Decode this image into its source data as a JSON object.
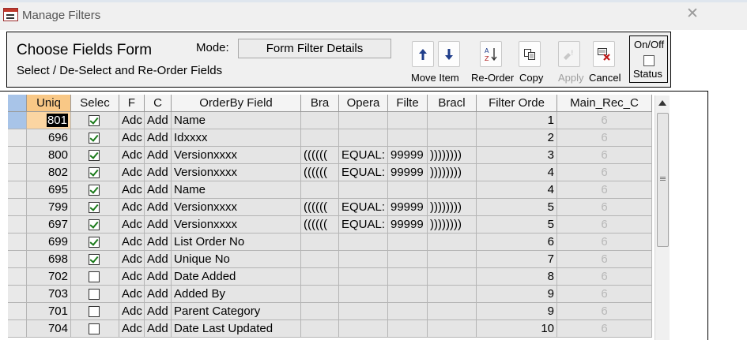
{
  "window": {
    "title": "Manage Filters",
    "close_icon": "close-icon"
  },
  "header": {
    "title": "Choose Fields Form",
    "subtitle": "Select / De-Select and Re-Order Fields",
    "mode_label": "Mode:",
    "mode_value": "Form Filter Details",
    "buttons": {
      "move_label": "Move Item",
      "reorder_label": "Re-Order",
      "copy_label": "Copy",
      "apply_label": "Apply",
      "cancel_label": "Cancel"
    },
    "onoff": {
      "label": "On/Off",
      "status_label": "Status",
      "checked": false
    }
  },
  "grid": {
    "columns": [
      "Uniq",
      "Selec",
      "F",
      "C",
      "OrderBy Field",
      "Bra",
      "Opera",
      "Filte",
      "Bracl",
      "Filter Orde",
      "Main_Rec_C"
    ],
    "rows": [
      {
        "uniq": "801",
        "selected": true,
        "f": "Adc",
        "c": "Add",
        "field": "Name",
        "bra": "",
        "op": "",
        "filter": "",
        "bracl": "",
        "order": "1",
        "main": "6"
      },
      {
        "uniq": "696",
        "selected": true,
        "f": "Adc",
        "c": "Add",
        "field": "Idxxxx",
        "bra": "",
        "op": "",
        "filter": "",
        "bracl": "",
        "order": "2",
        "main": "6"
      },
      {
        "uniq": "800",
        "selected": true,
        "f": "Adc",
        "c": "Add",
        "field": "Versionxxxx",
        "bra": "((((((",
        "op": "EQUAL:",
        "filter": "99999",
        "bracl": "))))))))",
        "order": "3",
        "main": "6"
      },
      {
        "uniq": "802",
        "selected": true,
        "f": "Adc",
        "c": "Add",
        "field": "Versionxxxx",
        "bra": "((((((",
        "op": "EQUAL:",
        "filter": "99999",
        "bracl": "))))))))",
        "order": "4",
        "main": "6"
      },
      {
        "uniq": "695",
        "selected": true,
        "f": "Adc",
        "c": "Add",
        "field": "Name",
        "bra": "",
        "op": "",
        "filter": "",
        "bracl": "",
        "order": "4",
        "main": "6"
      },
      {
        "uniq": "799",
        "selected": true,
        "f": "Adc",
        "c": "Add",
        "field": "Versionxxxx",
        "bra": "((((((",
        "op": "EQUAL:",
        "filter": "99999",
        "bracl": "))))))))",
        "order": "5",
        "main": "6"
      },
      {
        "uniq": "697",
        "selected": true,
        "f": "Adc",
        "c": "Add",
        "field": "Versionxxxx",
        "bra": "((((((",
        "op": "EQUAL:",
        "filter": "99999",
        "bracl": "))))))))",
        "order": "5",
        "main": "6"
      },
      {
        "uniq": "699",
        "selected": true,
        "f": "Adc",
        "c": "Add",
        "field": "List Order No",
        "bra": "",
        "op": "",
        "filter": "",
        "bracl": "",
        "order": "6",
        "main": "6"
      },
      {
        "uniq": "698",
        "selected": true,
        "f": "Adc",
        "c": "Add",
        "field": "Unique No",
        "bra": "",
        "op": "",
        "filter": "",
        "bracl": "",
        "order": "7",
        "main": "6"
      },
      {
        "uniq": "702",
        "selected": false,
        "f": "Adc",
        "c": "Add",
        "field": "Date Added",
        "bra": "",
        "op": "",
        "filter": "",
        "bracl": "",
        "order": "8",
        "main": "6"
      },
      {
        "uniq": "703",
        "selected": false,
        "f": "Adc",
        "c": "Add",
        "field": "Added By",
        "bra": "",
        "op": "",
        "filter": "",
        "bracl": "",
        "order": "9",
        "main": "6"
      },
      {
        "uniq": "701",
        "selected": false,
        "f": "Adc",
        "c": "Add",
        "field": "Parent Category",
        "bra": "",
        "op": "",
        "filter": "",
        "bracl": "",
        "order": "9",
        "main": "6"
      },
      {
        "uniq": "704",
        "selected": false,
        "f": "Adc",
        "c": "Add",
        "field": "Date Last Updated",
        "bra": "",
        "op": "",
        "filter": "",
        "bracl": "",
        "order": "10",
        "main": "6"
      }
    ]
  }
}
